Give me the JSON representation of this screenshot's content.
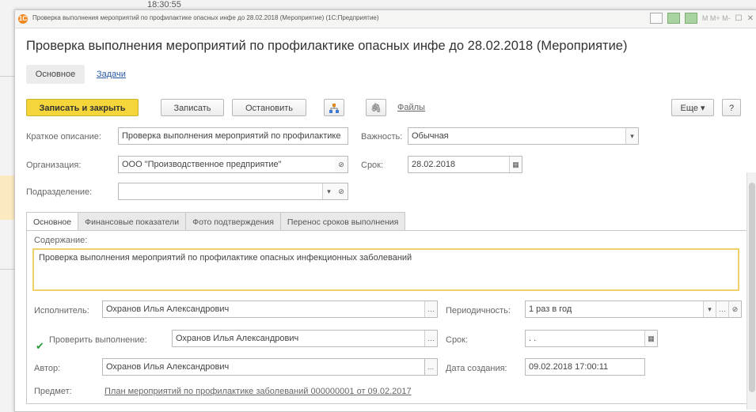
{
  "background": {
    "time": "18:30:55"
  },
  "titlebar": {
    "text": "Проверка выполнения мероприятий по профилактике опасных инфе до 28.02.2018 (Мероприятие)  (1С:Предприятие)",
    "m_buttons": "M  M+  M-"
  },
  "heading": "Проверка выполнения мероприятий по профилактике опасных инфе до 28.02.2018 (Мероприятие)",
  "form_tabs": {
    "main": "Основное",
    "tasks": "Задачи"
  },
  "toolbar": {
    "save_close": "Записать и закрыть",
    "save": "Записать",
    "stop": "Остановить",
    "files": "Файлы",
    "more": "Еще ▾",
    "help": "?"
  },
  "fields": {
    "short_desc_label": "Краткое описание:",
    "short_desc_value": "Проверка выполнения мероприятий по профилактике",
    "importance_label": "Важность:",
    "importance_value": "Обычная",
    "org_label": "Организация:",
    "org_value": "ООО \"Производственное предприятие\"",
    "deadline_label": "Срок:",
    "deadline_value": "28.02.2018",
    "division_label": "Подразделение:",
    "division_value": ""
  },
  "inner_tabs": [
    "Основное",
    "Финансовые показатели",
    "Фото подтверждения",
    "Перенос сроков выполнения"
  ],
  "content": {
    "label": "Содержание:",
    "text": "Проверка выполнения мероприятий по профилактике опасных инфекционных заболеваний"
  },
  "details": {
    "executor_label": "Исполнитель:",
    "executor_value": "Охранов Илья Александрович",
    "period_label": "Периодичность:",
    "period_value": "1 раз в год",
    "check_label": "Проверить выполнение:",
    "check_value": "Охранов Илья Александрович",
    "check_deadline_label": "Срок:",
    "check_deadline_value": ". .",
    "author_label": "Автор:",
    "author_value": "Охранов Илья Александрович",
    "created_label": "Дата создания:",
    "created_value": "09.02.2018 17:00:11",
    "subject_label": "Предмет:",
    "subject_value": "План мероприятий по профилактике заболеваний 000000001 от 09.02.2017"
  },
  "colors": {
    "accent_yellow": "#f5d63a",
    "link": "#2a5aa8",
    "check_green": "#2f9a3a"
  }
}
